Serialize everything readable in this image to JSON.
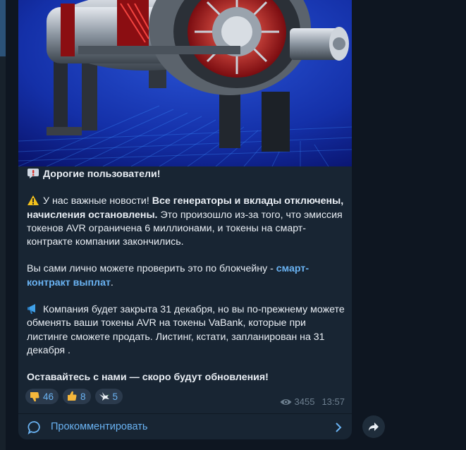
{
  "message": {
    "greeting": "Дорогие пользователи!",
    "p1_pre": "У нас важные новости! ",
    "p1_bold": "Все генераторы и вклады отключены, начисления остановлены.",
    "p1_rest": " Это произошло из-за того, что эмиссия токенов AVR ограничена 6 миллионами, и токены на смарт-контракте компании закончились.",
    "p2_pre": "Вы сами лично можете проверить это по блокчейну - ",
    "p2_link": "смарт-контракт выплат",
    "p2_post": ".",
    "p3": "Компания будет закрыта 31 декабря, но вы по-прежнему можете обменять ваши токены AVR на токены VaBank, которые при листинге сможете продать. Листинг, кстати, запланирован на 31 декабря .",
    "closing": "Оставайтесь с нами — скоро будут обновления!"
  },
  "reactions": [
    {
      "emoji": "thumbs-down",
      "count": "46"
    },
    {
      "emoji": "thumbs-up",
      "count": "8"
    },
    {
      "emoji": "dove",
      "count": "5"
    }
  ],
  "meta": {
    "views": "3455",
    "time": "13:57"
  },
  "comment": {
    "label": "Прокомментировать"
  },
  "icons": {
    "greeting": "speech-bubble-exclamation-icon",
    "warning": "warning-icon",
    "announce": "megaphone-icon",
    "views": "eye-icon",
    "comment": "comment-bubble-icon",
    "chevron": "chevron-right-icon",
    "share": "share-arrow-icon"
  },
  "colors": {
    "accent": "#6ab3f3",
    "bubble": "#182533",
    "background": "#0e1621"
  }
}
